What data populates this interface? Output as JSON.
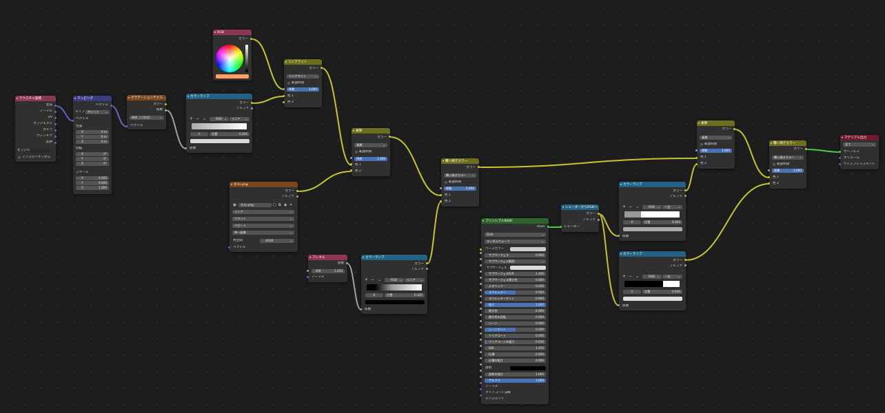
{
  "colors": {
    "canvas": "#1d1d1d",
    "header_input": "#8e3553",
    "header_vector": "#3c3c83",
    "header_texture": "#79461d",
    "header_converter": "#246283",
    "header_color": "#6e6e1d",
    "header_shader": "#2b652b",
    "header_output": "#6e1d2e",
    "socket_color": "#c7c729",
    "socket_float": "#a1a1a1",
    "socket_vector": "#6363c7",
    "socket_shader": "#4dcb4d",
    "wire_color": "#c7c729",
    "wire_float": "#a1a1a1",
    "wire_vector": "#6363c7",
    "wire_shader": "#4dcb4d",
    "field_blue": "#4772b3"
  },
  "nodes": {
    "texcoord": {
      "title": "テクスチャ座標",
      "outputs": [
        "生成",
        "ノーマル",
        "UV",
        "オブジェクト",
        "カメラ",
        "ウィンドウ",
        "反射"
      ],
      "object_label": "オブジェ...",
      "instancer_label": "インスタンサーから"
    },
    "mapping": {
      "title": "マッピング",
      "output": "ベクトル",
      "type_label": "タイプ",
      "type_value": "ポイント",
      "vector_input": "ベクトル",
      "location_label": "位置",
      "location": [
        {
          "axis": "X",
          "value": "0 m"
        },
        {
          "axis": "Y",
          "value": "0 m"
        },
        {
          "axis": "Z",
          "value": "0 m"
        }
      ],
      "rotation_label": "回転",
      "rotation": [
        {
          "axis": "X",
          "value": "0°"
        },
        {
          "axis": "Y",
          "value": "0°"
        },
        {
          "axis": "Z",
          "value": "0°"
        }
      ],
      "scale_label": "スケール",
      "scale": [
        {
          "axis": "X",
          "value": "0.000"
        },
        {
          "axis": "Y",
          "value": "0.000"
        },
        {
          "axis": "Z",
          "value": "1.000"
        }
      ]
    },
    "gradient": {
      "title": "グラデーションテクス...",
      "out_color": "カラー",
      "out_fac": "係数",
      "type_value": "球状（二次式）",
      "vector_input": "ベクトル"
    },
    "ramp1": {
      "title": "カラーランプ",
      "out_color": "カラー",
      "out_alpha": "アルファ",
      "mode": "RGB",
      "interp": "リニア",
      "index": "1",
      "pos_label": "位置",
      "pos_value": "0.200",
      "fac_input": "係数"
    },
    "rgb": {
      "title": "RGB",
      "out_color": "カラー"
    },
    "linearlight": {
      "title": "リニアライト",
      "out_color": "カラー",
      "blend": "リニアライト",
      "clamp": "範囲制限",
      "fac_label": "係数",
      "fac_value": "1.000",
      "fac_fraction": 1.0,
      "in1": "色 1",
      "in2": "色 2"
    },
    "multiply1": {
      "title": "乗算",
      "out_color": "カラー",
      "blend": "乗算",
      "clamp": "範囲制限",
      "fac_label": "係数",
      "fac_value": "1.000",
      "fac_fraction": 1.0,
      "in1": "色 1",
      "in2": "色 2"
    },
    "image": {
      "title": "ホルi.png",
      "out_color": "カラー",
      "out_alpha": "アルファ",
      "filename": "ホルi.png",
      "interp": "リニア",
      "projection": "フラット",
      "extension": "リピート",
      "source": "単一画像",
      "colorspace_label": "色空間",
      "colorspace_value": "sRGB",
      "vector_input": "ベクトル"
    },
    "fresnel": {
      "title": "フレネル",
      "out_fac": "係数",
      "ior_label": "IOR",
      "ior_value": "1.450",
      "normal_input": "ノーマル"
    },
    "ramp2": {
      "title": "カラーランプ",
      "out_color": "カラー",
      "out_alpha": "アルファ",
      "mode": "RGB",
      "interp": "リニア",
      "index": "0",
      "pos_label": "位置",
      "pos_value": "0.335",
      "fac_input": "係数"
    },
    "overlay1": {
      "title": "覆い焼きカラー",
      "out_color": "カラー",
      "blend": "覆い焼きカラー",
      "clamp": "範囲制限",
      "fac_label": "係数",
      "fac_value": "1.000",
      "fac_fraction": 1.0,
      "in1": "色 1",
      "in2": "色 2"
    },
    "principled": {
      "title": "プリンシプルBSDF",
      "out_bsdf": "BSDF",
      "distribution": "GGX",
      "subsurface_method": "ランダムウォーク",
      "base_color": "ベースカラー",
      "rows": [
        {
          "label": "サブサーフェス",
          "value": "0.000",
          "fill": 0.0
        },
        {
          "label": "サブサーフェス範囲",
          "value": "",
          "fill": 0.0,
          "dropdown": true
        },
        {
          "label": "サブサーフェス...",
          "value": "",
          "fill": 0.0,
          "white": true
        },
        {
          "label": "サブサーフェスIOR",
          "value": "1.400",
          "fill": 0.0
        },
        {
          "label": "サブサーフェス異方性",
          "value": "0.000",
          "fill": 0.0
        },
        {
          "label": "メタリック",
          "value": "0.000",
          "fill": 0.0
        },
        {
          "label": "スペキュラー",
          "value": "0.500",
          "fill": 0.5
        },
        {
          "label": "スペキュラーチント",
          "value": "0.000",
          "fill": 0.0
        },
        {
          "label": "粗さ",
          "value": "1.000",
          "fill": 1.0
        },
        {
          "label": "異方性",
          "value": "0.000",
          "fill": 0.0
        },
        {
          "label": "異方性の回転",
          "value": "0.000",
          "fill": 0.0
        },
        {
          "label": "シーン",
          "value": "0.000",
          "fill": 0.0
        },
        {
          "label": "シーンチント",
          "value": "0.500",
          "fill": 0.5
        },
        {
          "label": "クリアコート",
          "value": "0.000",
          "fill": 0.0
        },
        {
          "label": "クリアコートの粗さ",
          "value": "0.030",
          "fill": 0.03
        },
        {
          "label": "IOR",
          "value": "1.450",
          "fill": 0.0
        },
        {
          "label": "伝播",
          "value": "0.000",
          "fill": 0.0
        },
        {
          "label": "伝播の粗さ",
          "value": "0.000",
          "fill": 0.0
        }
      ],
      "emission": "放射",
      "emission_strength": {
        "label": "放射の強さ",
        "value": "1.000"
      },
      "alpha": {
        "label": "アルファ",
        "value": "1.000",
        "fill": 1.0
      },
      "normal": "ノーマル",
      "clearcoat_normal": "クリアコート法線",
      "tangent": "タンジェント"
    },
    "shader_rgb": {
      "title": "シェーダーからRGBへ",
      "out_color": "カラー",
      "out_alpha": "アルファ",
      "in_shader": "シェーダー"
    },
    "ramp3": {
      "title": "カラーランプ",
      "out_color": "カラー",
      "out_alpha": "アルファ",
      "mode": "RGB",
      "interp": "一定",
      "index": "0",
      "pos_label": "位置",
      "pos_value": "0.000",
      "fac_input": "係数"
    },
    "ramp4": {
      "title": "カラーランプ",
      "out_color": "カラー",
      "out_alpha": "アルファ",
      "mode": "RGB",
      "interp": "一定",
      "index": "1",
      "pos_label": "位置",
      "pos_value": "0.930",
      "fac_input": "係数"
    },
    "multiply2": {
      "title": "乗算",
      "out_color": "カラー",
      "blend": "乗算",
      "clamp": "範囲制限",
      "fac_label": "係数",
      "fac_value": "1.000",
      "fac_fraction": 1.0,
      "in1": "色 1",
      "in2": "色 2"
    },
    "overlay2": {
      "title": "覆い焼きカラー",
      "out_color": "カラー",
      "blend": "覆い焼きカラー",
      "clamp": "範囲制限",
      "fac_label": "係数",
      "fac_value": "1.000",
      "fac_fraction": 1.0,
      "in1": "色 1",
      "in2": "色 2"
    },
    "output": {
      "title": "マテリアル出力",
      "target": "全て",
      "in_surface": "サーフェス",
      "in_volume": "ボリューム",
      "in_displacement": "ディスプレイスメント"
    }
  }
}
